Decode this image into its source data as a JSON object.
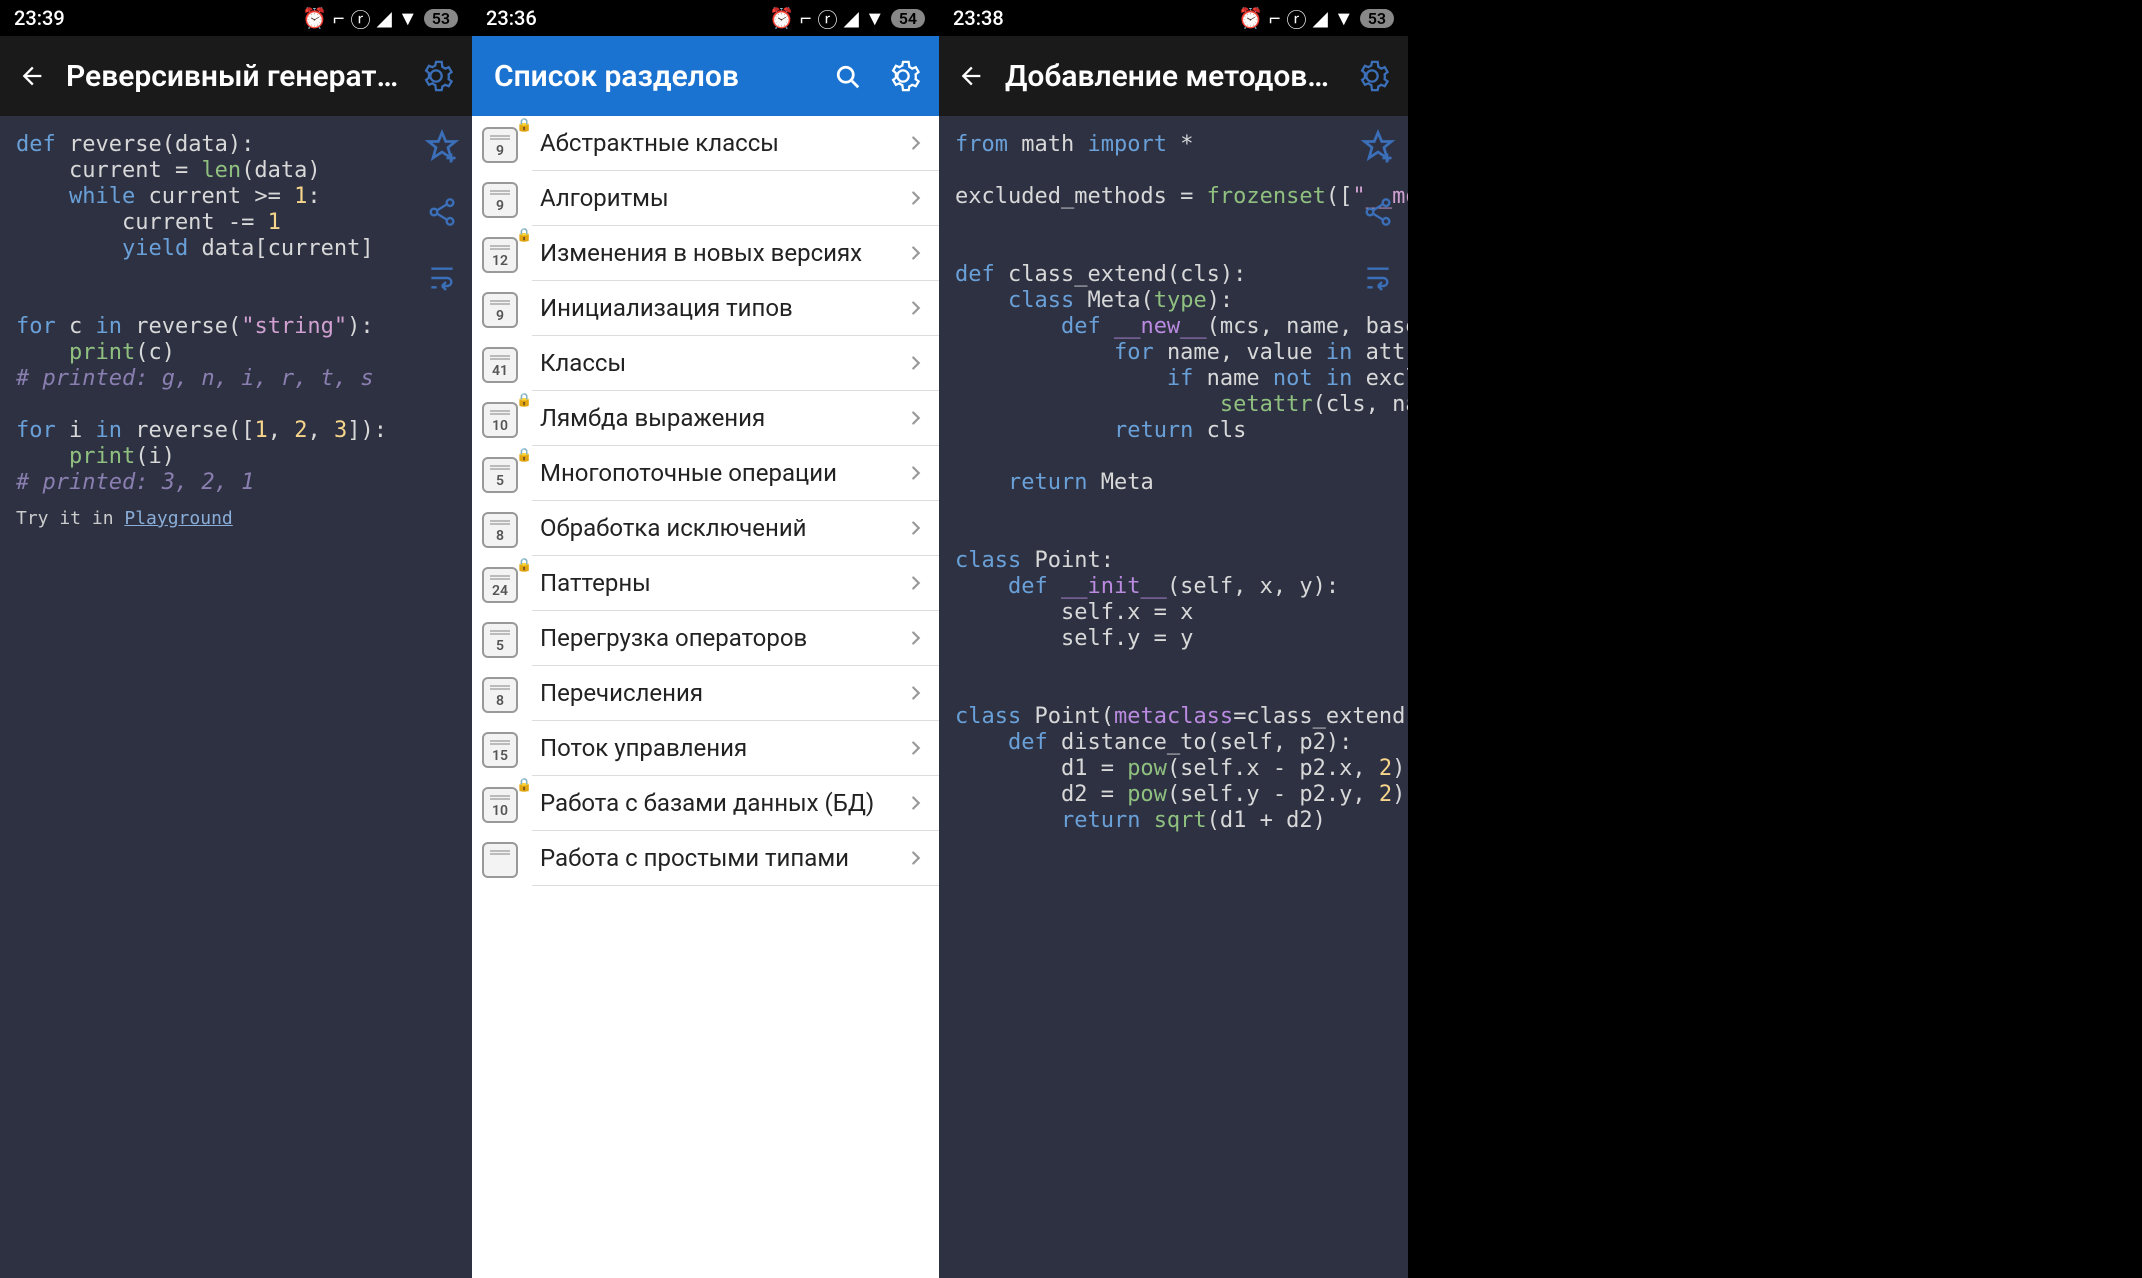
{
  "pane1": {
    "status": {
      "time": "23:39",
      "battery": "53"
    },
    "title": "Реверсивный генерат…",
    "code_tokens": [
      [
        {
          "t": "def ",
          "c": "kw"
        },
        {
          "t": "reverse(data):"
        }
      ],
      [
        {
          "t": "    current = "
        },
        {
          "t": "len",
          "c": "bi"
        },
        {
          "t": "(data)"
        }
      ],
      [
        {
          "t": "    "
        },
        {
          "t": "while",
          "c": "kw"
        },
        {
          "t": " current >= "
        },
        {
          "t": "1",
          "c": "num"
        },
        {
          "t": ":"
        }
      ],
      [
        {
          "t": "        current -= "
        },
        {
          "t": "1",
          "c": "num"
        }
      ],
      [
        {
          "t": "        "
        },
        {
          "t": "yield",
          "c": "kw"
        },
        {
          "t": " data[current]"
        }
      ],
      [
        {
          "t": ""
        }
      ],
      [
        {
          "t": ""
        }
      ],
      [
        {
          "t": "for ",
          "c": "kw"
        },
        {
          "t": "c "
        },
        {
          "t": "in ",
          "c": "kw"
        },
        {
          "t": "reverse("
        },
        {
          "t": "\"string\"",
          "c": "str"
        },
        {
          "t": "):"
        }
      ],
      [
        {
          "t": "    "
        },
        {
          "t": "print",
          "c": "bi"
        },
        {
          "t": "(c)"
        }
      ],
      [
        {
          "t": "# printed: g, n, i, r, t, s",
          "c": "cm"
        }
      ],
      [
        {
          "t": ""
        }
      ],
      [
        {
          "t": "for ",
          "c": "kw"
        },
        {
          "t": "i "
        },
        {
          "t": "in ",
          "c": "kw"
        },
        {
          "t": "reverse(["
        },
        {
          "t": "1",
          "c": "num"
        },
        {
          "t": ", "
        },
        {
          "t": "2",
          "c": "num"
        },
        {
          "t": ", "
        },
        {
          "t": "3",
          "c": "num"
        },
        {
          "t": "]):"
        }
      ],
      [
        {
          "t": "    "
        },
        {
          "t": "print",
          "c": "bi"
        },
        {
          "t": "(i)"
        }
      ],
      [
        {
          "t": "# printed: 3, 2, 1",
          "c": "cm"
        }
      ]
    ],
    "footer_prefix": "Try it in ",
    "footer_link": "Playground"
  },
  "pane2": {
    "status": {
      "time": "23:36",
      "battery": "54"
    },
    "title": "Список разделов",
    "items": [
      {
        "n": "9",
        "lock": true,
        "label": "Абстрактные классы"
      },
      {
        "n": "9",
        "lock": false,
        "label": "Алгоритмы"
      },
      {
        "n": "12",
        "lock": true,
        "label": "Изменения в новых версиях"
      },
      {
        "n": "9",
        "lock": false,
        "label": "Инициализация типов"
      },
      {
        "n": "41",
        "lock": false,
        "label": "Классы"
      },
      {
        "n": "10",
        "lock": true,
        "label": "Лямбда выражения"
      },
      {
        "n": "5",
        "lock": true,
        "label": "Многопоточные операции"
      },
      {
        "n": "8",
        "lock": false,
        "label": "Обработка исключений"
      },
      {
        "n": "24",
        "lock": true,
        "label": "Паттерны"
      },
      {
        "n": "5",
        "lock": false,
        "label": "Перегрузка операторов"
      },
      {
        "n": "8",
        "lock": false,
        "label": "Перечисления"
      },
      {
        "n": "15",
        "lock": false,
        "label": "Поток управления"
      },
      {
        "n": "10",
        "lock": true,
        "label": "Работа с базами данных (БД)"
      },
      {
        "n": "",
        "lock": false,
        "label": "Работа с простыми типами"
      }
    ]
  },
  "pane3": {
    "status": {
      "time": "23:38",
      "battery": "53"
    },
    "title": "Добавление методов…",
    "code_tokens": [
      [
        {
          "t": "from ",
          "c": "kw"
        },
        {
          "t": "math "
        },
        {
          "t": "import ",
          "c": "kw"
        },
        {
          "t": "*"
        }
      ],
      [
        {
          "t": ""
        }
      ],
      [
        {
          "t": "excluded_methods = "
        },
        {
          "t": "frozenset",
          "c": "bi"
        },
        {
          "t": "(["
        },
        {
          "t": "\"__modu",
          "c": "str"
        }
      ],
      [
        {
          "t": ""
        }
      ],
      [
        {
          "t": ""
        }
      ],
      [
        {
          "t": "def ",
          "c": "kw"
        },
        {
          "t": "class_extend(cls):"
        }
      ],
      [
        {
          "t": "    "
        },
        {
          "t": "class ",
          "c": "kw"
        },
        {
          "t": "Meta("
        },
        {
          "t": "type",
          "c": "bi"
        },
        {
          "t": "):"
        }
      ],
      [
        {
          "t": "        "
        },
        {
          "t": "def ",
          "c": "kw"
        },
        {
          "t": "__new__",
          "c": "dun"
        },
        {
          "t": "(mcs, name, bases,"
        }
      ],
      [
        {
          "t": "            "
        },
        {
          "t": "for ",
          "c": "kw"
        },
        {
          "t": "name, value "
        },
        {
          "t": "in ",
          "c": "kw"
        },
        {
          "t": "attrs."
        }
      ],
      [
        {
          "t": "                "
        },
        {
          "t": "if ",
          "c": "kw"
        },
        {
          "t": "name "
        },
        {
          "t": "not in ",
          "c": "kw"
        },
        {
          "t": "exclud"
        }
      ],
      [
        {
          "t": "                    "
        },
        {
          "t": "setattr",
          "c": "bi"
        },
        {
          "t": "(cls, name"
        }
      ],
      [
        {
          "t": "            "
        },
        {
          "t": "return ",
          "c": "kw"
        },
        {
          "t": "cls"
        }
      ],
      [
        {
          "t": ""
        }
      ],
      [
        {
          "t": "    "
        },
        {
          "t": "return ",
          "c": "kw"
        },
        {
          "t": "Meta"
        }
      ],
      [
        {
          "t": ""
        }
      ],
      [
        {
          "t": ""
        }
      ],
      [
        {
          "t": "class ",
          "c": "kw"
        },
        {
          "t": "Point:"
        }
      ],
      [
        {
          "t": "    "
        },
        {
          "t": "def ",
          "c": "kw"
        },
        {
          "t": "__init__",
          "c": "dun"
        },
        {
          "t": "(self, x, y):"
        }
      ],
      [
        {
          "t": "        self.x = x"
        }
      ],
      [
        {
          "t": "        self.y = y"
        }
      ],
      [
        {
          "t": ""
        }
      ],
      [
        {
          "t": ""
        }
      ],
      [
        {
          "t": "class ",
          "c": "kw"
        },
        {
          "t": "Point("
        },
        {
          "t": "metaclass",
          "c": "dun"
        },
        {
          "t": "=class_extend(Po"
        }
      ],
      [
        {
          "t": "    "
        },
        {
          "t": "def ",
          "c": "kw"
        },
        {
          "t": "distance_to(self, p2):"
        }
      ],
      [
        {
          "t": "        d1 = "
        },
        {
          "t": "pow",
          "c": "bi"
        },
        {
          "t": "(self.x - p2.x, "
        },
        {
          "t": "2",
          "c": "num"
        },
        {
          "t": ")"
        }
      ],
      [
        {
          "t": "        d2 = "
        },
        {
          "t": "pow",
          "c": "bi"
        },
        {
          "t": "(self.y - p2.y, "
        },
        {
          "t": "2",
          "c": "num"
        },
        {
          "t": ")"
        }
      ],
      [
        {
          "t": "        "
        },
        {
          "t": "return ",
          "c": "kw"
        },
        {
          "t": "sqrt",
          "c": "bi"
        },
        {
          "t": "(d1 + d2)"
        }
      ]
    ]
  }
}
